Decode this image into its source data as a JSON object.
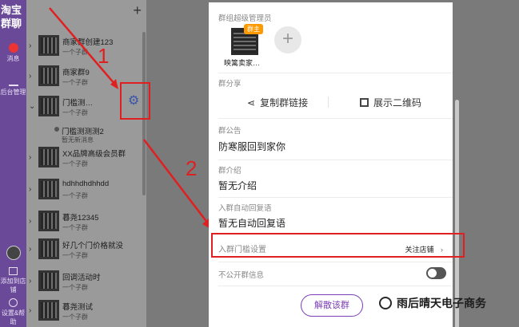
{
  "rail": {
    "logo": "淘宝\n群聊",
    "messages": "消息",
    "backend": "后台管理",
    "add_to_shop": "添加到店铺",
    "settings_help": "设置&帮助"
  },
  "list": {
    "plus": "+",
    "groups": [
      {
        "name": "商家群创建123",
        "sub": "一个子群"
      },
      {
        "name": "商家群9",
        "sub": "一个子群"
      },
      {
        "name": "门槛测…",
        "sub": "一个子群"
      },
      {
        "name": "XX品牌高级会员群",
        "sub": "一个子群"
      },
      {
        "name": "hdhhdhdhhdd",
        "sub": "一个子群"
      },
      {
        "name": "暮尧12345",
        "sub": "一个子群"
      },
      {
        "name": "好几个门价格就没",
        "sub": "一个子群"
      },
      {
        "name": "回调活动时",
        "sub": "一个子群"
      },
      {
        "name": "暮尧测试",
        "sub": "一个子群"
      }
    ],
    "subgroup": {
      "name": "门槛测测测2",
      "sub": "暂无新消息"
    }
  },
  "annotations": {
    "one": "1",
    "two": "2"
  },
  "panel": {
    "super_admin_label": "群组超级管理员",
    "owner_badge": "群主",
    "admin_name": "映篱卖家…",
    "share_label": "群分享",
    "copy_link": "复制群链接",
    "show_qr": "展示二维码",
    "notice_label": "群公告",
    "notice_value": "防寒服回到家你",
    "intro_label": "群介绍",
    "intro_value": "暂无介绍",
    "auto_reply_label": "入群自动回复语",
    "auto_reply_value": "暂无自动回复语",
    "entry_label": "入群门槛设置",
    "entry_value": "关注店铺",
    "private_label": "不公开群信息",
    "dismiss": "解散该群"
  },
  "watermark": "雨后晴天电子商务"
}
